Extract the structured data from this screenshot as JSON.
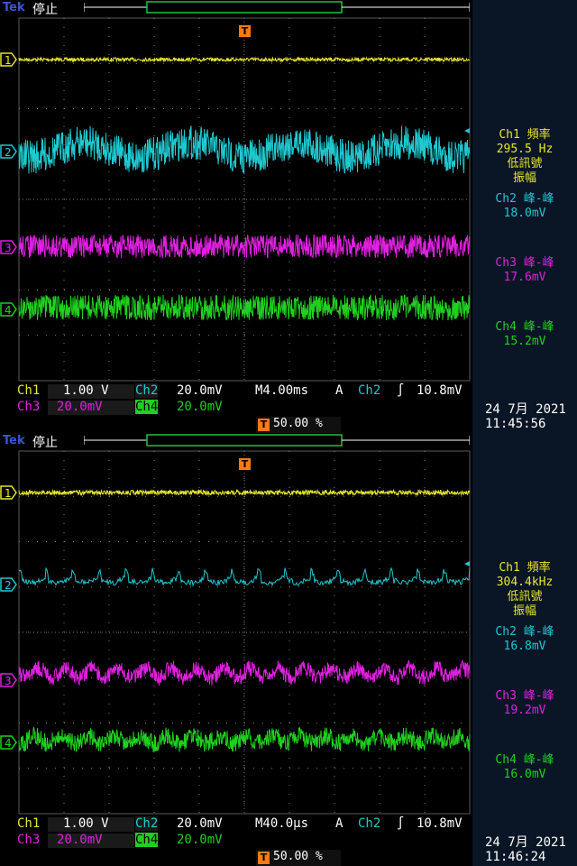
{
  "screens": [
    {
      "brand": "Tek",
      "run_state": "停止",
      "measurements": [
        {
          "line1": "Ch1 頻率",
          "line2": "295.5 Hz",
          "line3": "低訊號",
          "line4": "振幅"
        },
        {
          "line1": "Ch2 峰-峰",
          "line2": "18.0mV"
        },
        {
          "line1": "Ch3 峰-峰",
          "line2": "17.6mV"
        },
        {
          "line1": "Ch4 峰-峰",
          "line2": "15.2mV"
        }
      ],
      "ch1_label": "Ch1",
      "ch1_scale": "1.00 V",
      "ch2_label": "Ch2",
      "ch2_scale": "20.0mV",
      "ch3_label": "Ch3",
      "ch3_scale": "20.0mV",
      "ch4_label": "Ch4",
      "ch4_scale": "20.0mV",
      "timebase": "M4.00ms",
      "trigger_mode": "A",
      "trigger_source": "Ch2",
      "trigger_level": "10.8mV",
      "trigger_position": "50.00 %",
      "date": "24 7月  2021",
      "time": "11:45:56",
      "channel_markers": [
        "1",
        "2",
        "3",
        "4"
      ],
      "trigger_marker": "T"
    },
    {
      "brand": "Tek",
      "run_state": "停止",
      "measurements": [
        {
          "line1": "Ch1 頻率",
          "line2": "304.4kHz",
          "line3": "低訊號",
          "line4": "振幅"
        },
        {
          "line1": "Ch2 峰-峰",
          "line2": "16.8mV"
        },
        {
          "line1": "Ch3 峰-峰",
          "line2": "19.2mV"
        },
        {
          "line1": "Ch4 峰-峰",
          "line2": "16.0mV"
        }
      ],
      "ch1_label": "Ch1",
      "ch1_scale": "1.00 V",
      "ch2_label": "Ch2",
      "ch2_scale": "20.0mV",
      "ch3_label": "Ch3",
      "ch3_scale": "20.0mV",
      "ch4_label": "Ch4",
      "ch4_scale": "20.0mV",
      "timebase": "M40.0µs",
      "trigger_mode": "A",
      "trigger_source": "Ch2",
      "trigger_level": "10.8mV",
      "trigger_position": "50.00 %",
      "date": "24 7月  2021",
      "time": "11:46:24",
      "channel_markers": [
        "1",
        "2",
        "3",
        "4"
      ],
      "trigger_marker": "T"
    }
  ],
  "colors": {
    "ch1": "#e6e62e",
    "ch2": "#20c8d0",
    "ch3": "#e020e0",
    "ch4": "#20d020",
    "trigger": "#ff7a14",
    "grid": "#7a7a7a"
  }
}
